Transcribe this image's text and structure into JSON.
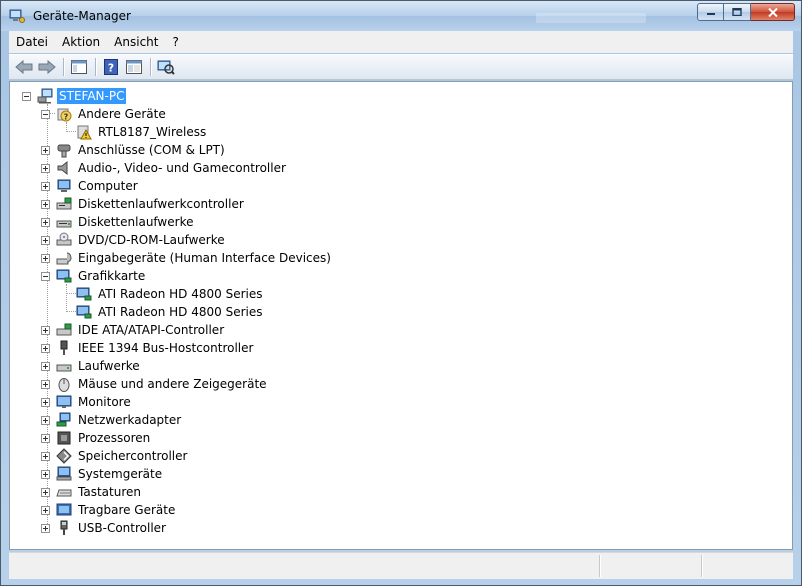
{
  "window": {
    "title": "Geräte-Manager"
  },
  "menu": [
    {
      "id": "datei",
      "label": "Datei"
    },
    {
      "id": "aktion",
      "label": "Aktion"
    },
    {
      "id": "ansicht",
      "label": "Ansicht"
    },
    {
      "id": "help",
      "label": "?"
    }
  ],
  "toolbar": {
    "buttons": [
      "back-icon",
      "forward-icon",
      "show-hide-console-tree-icon",
      "help-icon",
      "properties-icon",
      "scan-hardware-icon"
    ]
  },
  "tree": {
    "root": {
      "label": "STEFAN-PC",
      "icon": "computer-network-icon"
    },
    "andere": {
      "label": "Andere Geräte",
      "icon": "unknown-device-icon",
      "child": "RTL8187_Wireless",
      "child_icon": "warning-device-icon"
    },
    "categories": [
      {
        "label": "Anschlüsse (COM & LPT)",
        "icon": "port-icon"
      },
      {
        "label": "Audio-, Video- und Gamecontroller",
        "icon": "speaker-icon"
      },
      {
        "label": "Computer",
        "icon": "computer-icon"
      },
      {
        "label": "Diskettenlaufwerkcontroller",
        "icon": "floppy-controller-icon"
      },
      {
        "label": "Diskettenlaufwerke",
        "icon": "floppy-drive-icon"
      },
      {
        "label": "DVD/CD-ROM-Laufwerke",
        "icon": "dvd-drive-icon"
      },
      {
        "label": "Eingabegeräte (Human Interface Devices)",
        "icon": "hid-icon"
      }
    ],
    "grafik": {
      "label": "Grafikkarte",
      "icon": "display-adapter-icon",
      "children": [
        "ATI Radeon HD 4800 Series",
        "ATI Radeon HD 4800 Series"
      ]
    },
    "categories2": [
      {
        "label": "IDE ATA/ATAPI-Controller",
        "icon": "ide-controller-icon"
      },
      {
        "label": "IEEE 1394 Bus-Hostcontroller",
        "icon": "firewire-icon"
      },
      {
        "label": "Laufwerke",
        "icon": "disk-drive-icon"
      },
      {
        "label": "Mäuse und andere Zeigegeräte",
        "icon": "mouse-icon"
      },
      {
        "label": "Monitore",
        "icon": "monitor-icon"
      },
      {
        "label": "Netzwerkadapter",
        "icon": "network-adapter-icon"
      },
      {
        "label": "Prozessoren",
        "icon": "processor-icon"
      },
      {
        "label": "Speichercontroller",
        "icon": "storage-controller-icon"
      },
      {
        "label": "Systemgeräte",
        "icon": "system-devices-icon"
      },
      {
        "label": "Tastaturen",
        "icon": "keyboard-icon"
      },
      {
        "label": "Tragbare Geräte",
        "icon": "portable-device-icon"
      },
      {
        "label": "USB-Controller",
        "icon": "usb-icon"
      }
    ]
  }
}
